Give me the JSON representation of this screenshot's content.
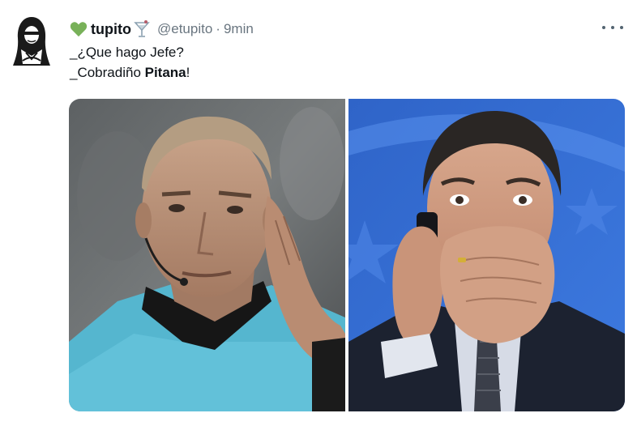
{
  "tweet": {
    "display_name": "tupito",
    "handle": "@etupito",
    "separator": "·",
    "time": "9min",
    "line1": "_¿Que hago Jefe?",
    "line2_prefix": "_Cobradiño ",
    "line2_bold": "Pitana",
    "line2_suffix": "!"
  },
  "icons": {
    "name_prefix": "green-heart-icon",
    "name_suffix": "cocktail-glass-icon",
    "more": "more-options-icon"
  },
  "colors": {
    "heart": "#78b159",
    "meta_text": "#6a7680",
    "body_text": "#0f1419"
  }
}
